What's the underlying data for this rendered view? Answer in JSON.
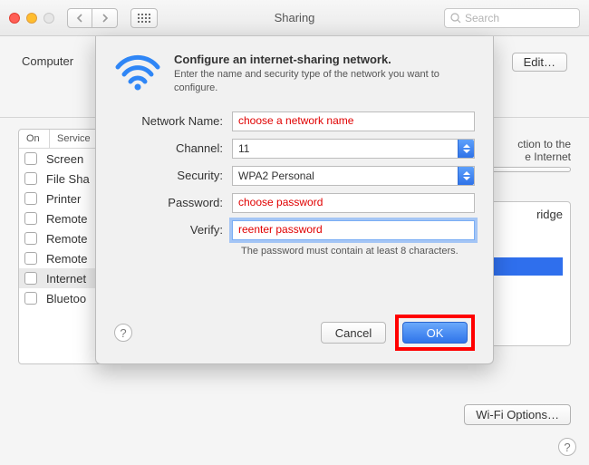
{
  "window": {
    "title": "Sharing",
    "search_placeholder": "Search"
  },
  "header": {
    "computer_label": "Computer",
    "edit_label": "Edit…"
  },
  "services": {
    "col_on": "On",
    "col_service": "Service",
    "items": [
      "Screen",
      "File Sha",
      "Printer",
      "Remote",
      "Remote",
      "Remote",
      "Internet",
      "Bluetoo"
    ],
    "selected_index": 6
  },
  "right": {
    "line1": "ction to the",
    "line2": "e Internet",
    "port_item": "ridge",
    "wifi_options_label": "Wi-Fi Options…"
  },
  "sheet": {
    "title": "Configure an internet-sharing network.",
    "subtitle": "Enter the name and security type of the network you want to configure.",
    "network_name_label": "Network Name:",
    "network_name_value": "choose a network name",
    "channel_label": "Channel:",
    "channel_value": "11",
    "security_label": "Security:",
    "security_value": "WPA2 Personal",
    "password_label": "Password:",
    "password_value": "choose password",
    "verify_label": "Verify:",
    "verify_value": "reenter password",
    "password_hint": "The password must contain at least 8 characters.",
    "cancel_label": "Cancel",
    "ok_label": "OK"
  }
}
